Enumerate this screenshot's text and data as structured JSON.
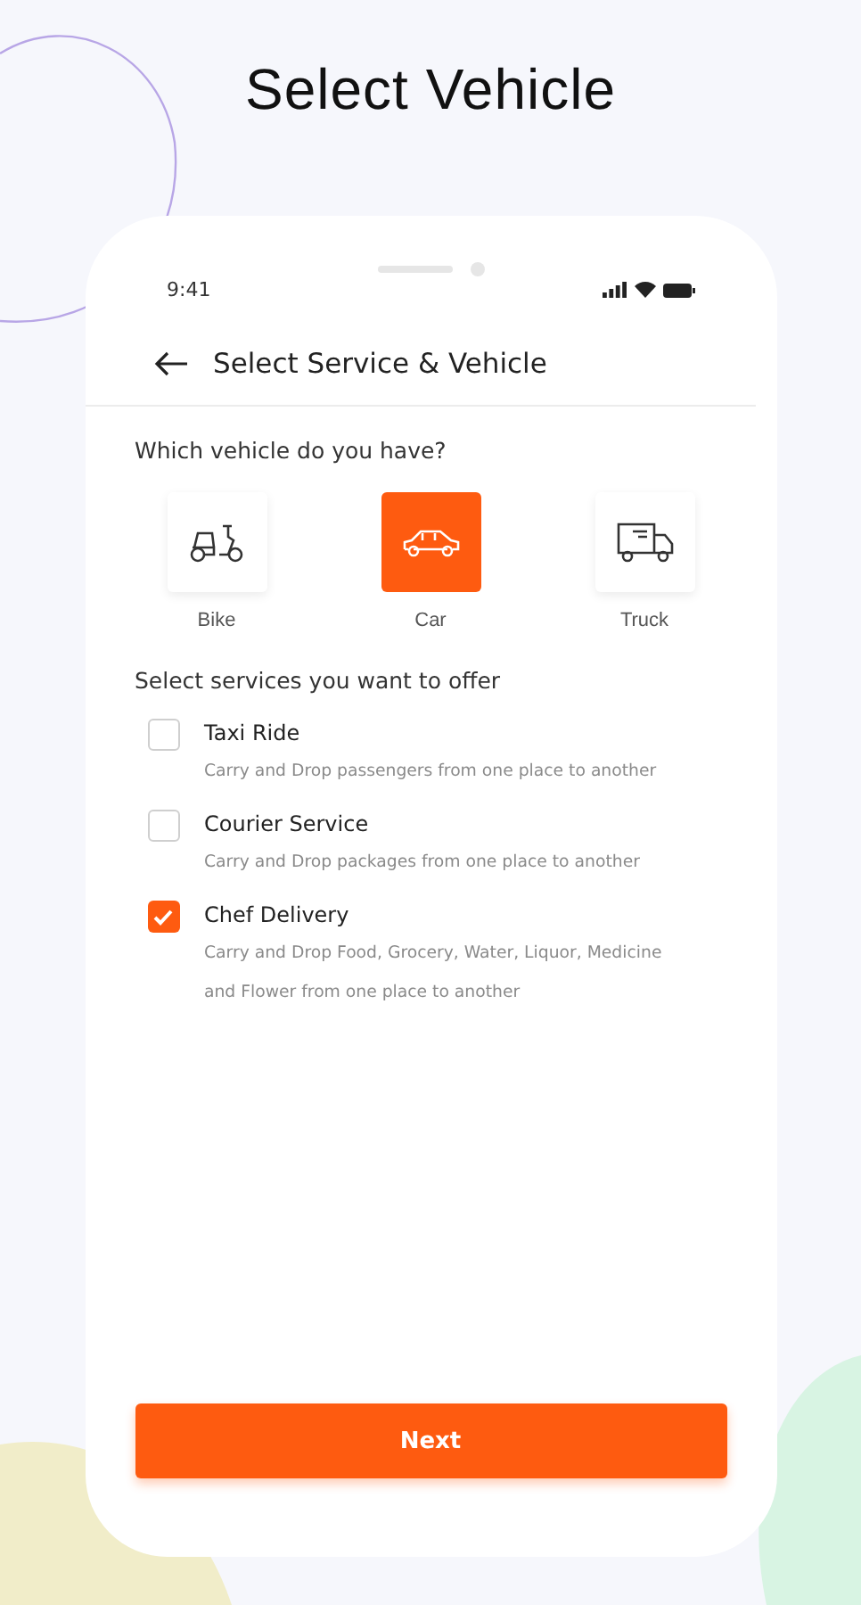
{
  "headline": "Select Vehicle",
  "status_bar": {
    "time": "9:41"
  },
  "header": {
    "title": "Select Service & Vehicle"
  },
  "vehicle_question": "Which vehicle do you have?",
  "vehicles": [
    {
      "kind": "bike",
      "label": "Bike",
      "selected": false
    },
    {
      "kind": "car",
      "label": "Car",
      "selected": true
    },
    {
      "kind": "truck",
      "label": "Truck",
      "selected": false
    }
  ],
  "services_title": "Select services you want to offer",
  "services": [
    {
      "name": "Taxi Ride",
      "description": "Carry and Drop passengers from one place to another",
      "checked": false
    },
    {
      "name": "Courier Service",
      "description": "Carry and Drop packages from one place to another",
      "checked": false
    },
    {
      "name": "Chef Delivery",
      "description": "Carry and Drop Food, Grocery, Water, Liquor, Medicine and Flower from one place to another",
      "checked": true
    }
  ],
  "next_button": "Next"
}
